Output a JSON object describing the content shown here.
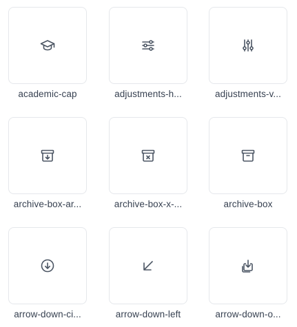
{
  "icons": [
    {
      "name": "academic-cap",
      "label": "academic-cap"
    },
    {
      "name": "adjustments-horizontal",
      "label": "adjustments-h..."
    },
    {
      "name": "adjustments-vertical",
      "label": "adjustments-v..."
    },
    {
      "name": "archive-box-arrow-down",
      "label": "archive-box-ar..."
    },
    {
      "name": "archive-box-x-mark",
      "label": "archive-box-x-..."
    },
    {
      "name": "archive-box",
      "label": "archive-box"
    },
    {
      "name": "arrow-down-circle",
      "label": "arrow-down-ci..."
    },
    {
      "name": "arrow-down-left",
      "label": "arrow-down-left"
    },
    {
      "name": "arrow-down-on-square",
      "label": "arrow-down-o..."
    }
  ],
  "colors": {
    "icon_stroke": "#4b5563",
    "card_border": "#e5e7eb",
    "label_text": "#374151"
  }
}
